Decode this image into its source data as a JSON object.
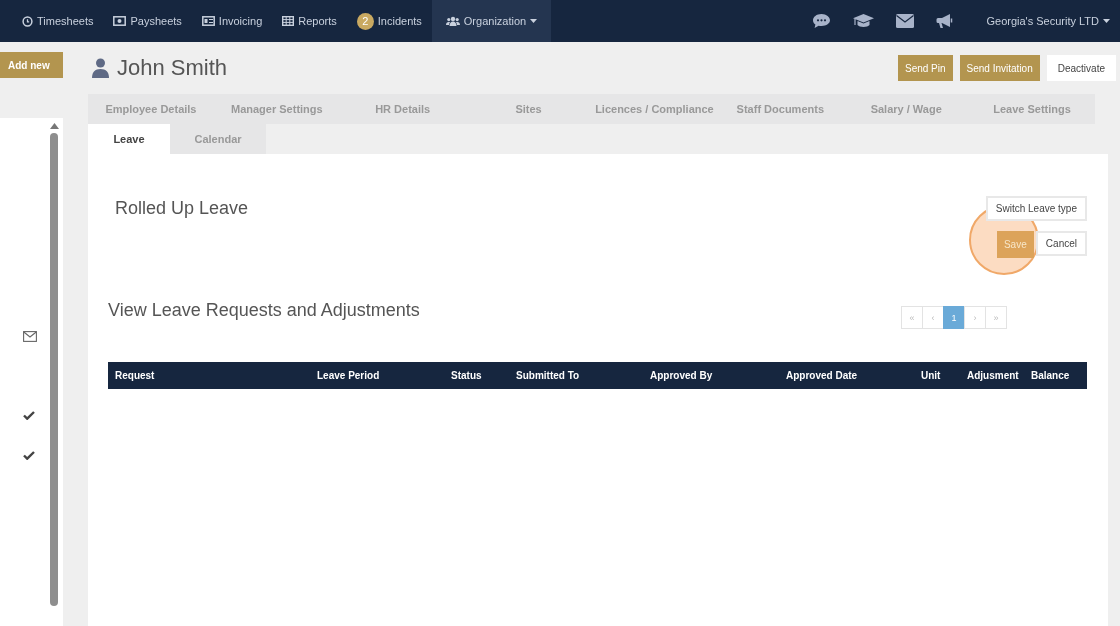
{
  "navbar": {
    "items": [
      {
        "label": "Timesheets",
        "selected": false
      },
      {
        "label": "Paysheets",
        "selected": false
      },
      {
        "label": "Invoicing",
        "selected": false
      },
      {
        "label": "Reports",
        "selected": false
      },
      {
        "label": "Incidents",
        "badge": "2",
        "selected": false
      },
      {
        "label": "Organization",
        "dropdown": true,
        "selected": true
      }
    ],
    "account": "Georgia's Security LTD"
  },
  "add_new": "Add new",
  "employee": {
    "name": "John Smith"
  },
  "actions": [
    {
      "label": "Send Pin",
      "kind": "primary"
    },
    {
      "label": "Send Invitation",
      "kind": "primary"
    },
    {
      "label": "Deactivate",
      "kind": "plain"
    }
  ],
  "tabs": [
    {
      "label": "Employee Details",
      "selected": false
    },
    {
      "label": "Manager Settings",
      "selected": false
    },
    {
      "label": "HR Details",
      "selected": false
    },
    {
      "label": "Sites",
      "selected": false
    },
    {
      "label": "Licences / Compliance",
      "selected": false
    },
    {
      "label": "Staff Documents",
      "selected": false
    },
    {
      "label": "Salary / Wage",
      "selected": false
    },
    {
      "label": "Leave Settings",
      "selected": false
    }
  ],
  "subtabs": [
    {
      "label": "Leave",
      "selected": true
    },
    {
      "label": "Calendar",
      "selected": false
    }
  ],
  "section_title": "Rolled Up Leave",
  "switch_button": "Switch Leave type",
  "save_button": "Save",
  "cancel_button": "Cancel",
  "requests_title": "View Leave Requests and Adjustments",
  "pagination": [
    {
      "label": "«",
      "selected": false
    },
    {
      "label": "‹",
      "selected": false
    },
    {
      "label": "1",
      "selected": true
    },
    {
      "label": "›",
      "selected": false
    },
    {
      "label": "»",
      "selected": false
    }
  ],
  "table": {
    "columns": [
      "Request",
      "Leave Period",
      "Status",
      "Submitted To",
      "Approved By",
      "Approved Date",
      "Unit",
      "Adjusment",
      "Balance"
    ]
  }
}
